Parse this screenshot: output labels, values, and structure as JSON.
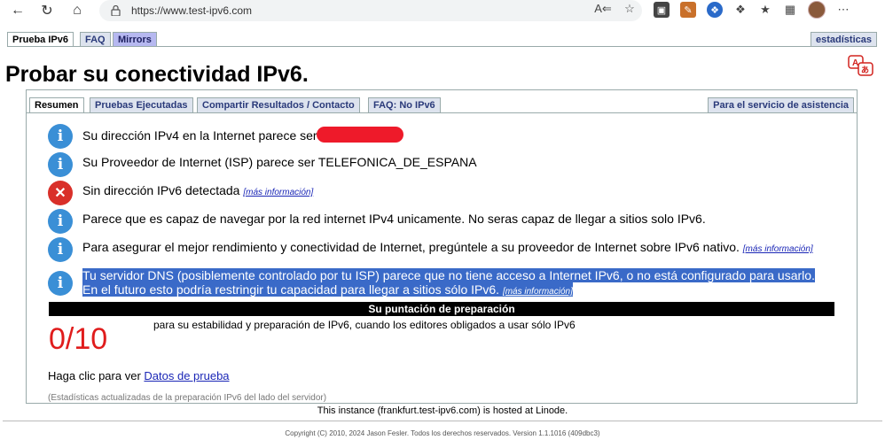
{
  "browser": {
    "url": "https://www.test-ipv6.com",
    "back_icon": "arrow-left-icon",
    "refresh_icon": "refresh-icon",
    "home_icon": "home-icon"
  },
  "top_tabs": {
    "prueba": "Prueba IPv6",
    "faq": "FAQ",
    "mirrors": "Mirrors",
    "stats": "estadísticas"
  },
  "page_title": "Probar su conectividad IPv6.",
  "sub_tabs": {
    "resumen": "Resumen",
    "pruebas": "Pruebas Ejecutadas",
    "compartir": "Compartir Resultados / Contacto",
    "faq_no": "FAQ: No IPv6",
    "asistencia": "Para el servicio de asistencia"
  },
  "messages": [
    {
      "text": "Su dirección IPv4 en la Internet parece ser"
    },
    {
      "text": "Su Proveedor de Internet (ISP) parece ser TELEFONICA_DE_ESPANA"
    },
    {
      "text": "Sin dirección IPv6 detectada",
      "more": "[más información]"
    },
    {
      "text": "Parece que es capaz de navegar por la red internet IPv4 unicamente. No seras capaz de llegar a sitios solo IPv6."
    },
    {
      "text": "Para asegurar el mejor rendimiento y conectividad de Internet, pregúntele a su proveedor de Internet sobre IPv6 nativo.",
      "more": "[más información]"
    },
    {
      "line1": "Tu servidor DNS (posiblemente controlado por tu ISP) parece que no tiene acceso a Internet IPv6, o no está configurado para usarlo.",
      "line2": "En el futuro esto podría restringir tu capacidad para llegar a sitios sólo IPv6.",
      "more": "[más información]"
    }
  ],
  "score_header": "Su puntación de preparación",
  "score": "0/10",
  "score_desc": "para su estabilidad y preparación de IPv6, cuando los editores obligados a usar sólo IPv6",
  "test_data": {
    "prefix": "Haga clic para ver",
    "link": "Datos de prueba"
  },
  "stats_note": "(Estadísticas actualizadas de la preparación IPv6 del lado del servidor)",
  "hosted": "This instance (frankfurt.test-ipv6.com) is hosted at Linode.",
  "copyright": "Copyright (C) 2010, 2024 Jason Fesler. Todos los derechos reservados. Version 1.1.1016 (409dbc3)",
  "colors": {
    "score_red": "#e01c1c",
    "info_blue": "#3a8fd6",
    "error_red": "#d9302a",
    "highlight": "#3a6ac8"
  }
}
